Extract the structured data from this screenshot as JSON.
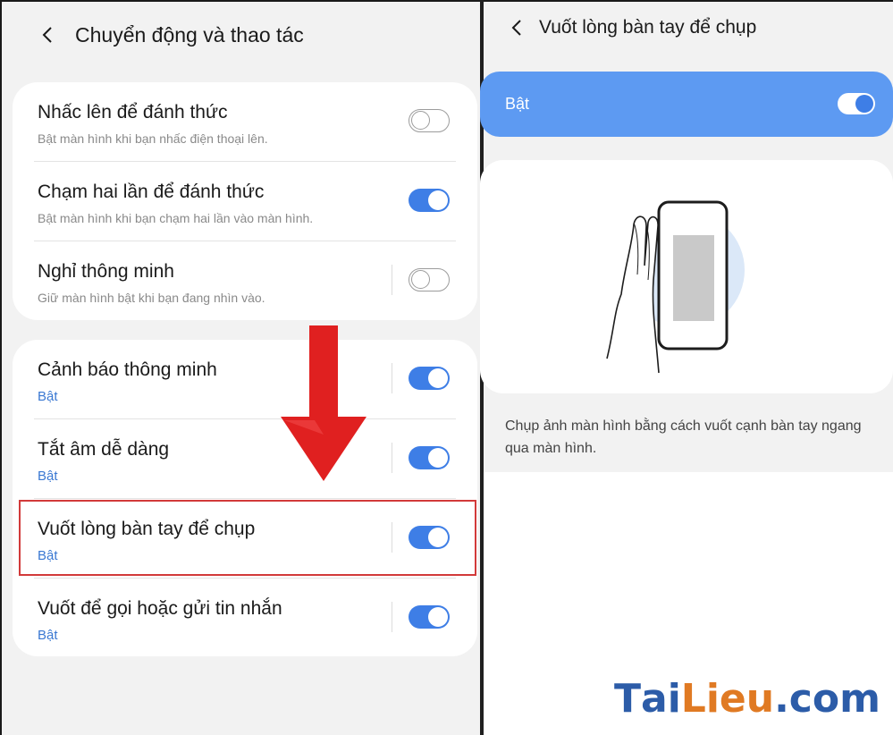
{
  "left": {
    "header": {
      "title": "Chuyển động và thao tác"
    },
    "group1": [
      {
        "title": "Nhấc lên để đánh thức",
        "subtitle": "Bật màn hình khi bạn nhấc điện thoại lên.",
        "on": false
      },
      {
        "title": "Chạm hai lần để đánh thức",
        "subtitle": "Bật màn hình khi bạn chạm hai lần vào màn hình.",
        "on": true
      },
      {
        "title": "Nghỉ thông minh",
        "subtitle": "Giữ màn hình bật khi bạn đang nhìn vào.",
        "on": false
      }
    ],
    "group2": [
      {
        "title": "Cảnh báo thông minh",
        "subtitle": "Bật",
        "on": true
      },
      {
        "title": "Tắt âm dễ dàng",
        "subtitle": "Bật",
        "on": true
      },
      {
        "title": "Vuốt lòng bàn tay để chụp",
        "subtitle": "Bật",
        "on": true,
        "highlighted": true
      },
      {
        "title": "Vuốt để gọi hoặc gửi tin nhắn",
        "subtitle": "Bật",
        "on": true
      }
    ]
  },
  "right": {
    "header": {
      "title": "Vuốt lòng bàn tay để chụp"
    },
    "master_switch": {
      "label": "Bật",
      "on": true
    },
    "description": "Chụp ảnh màn hình bằng cách vuốt cạnh bàn tay ngang qua màn hình."
  },
  "watermark": {
    "part1": "T",
    "part2": "ai",
    "part3": "Lieu",
    "part4": ".com"
  },
  "colors": {
    "accent": "#3e7ee6",
    "banner": "#5d9af2",
    "highlight": "#d23a3a",
    "arrow": "#e02020"
  },
  "icons": {
    "back": "chevron-left-icon",
    "arrow": "arrow-down-icon"
  }
}
